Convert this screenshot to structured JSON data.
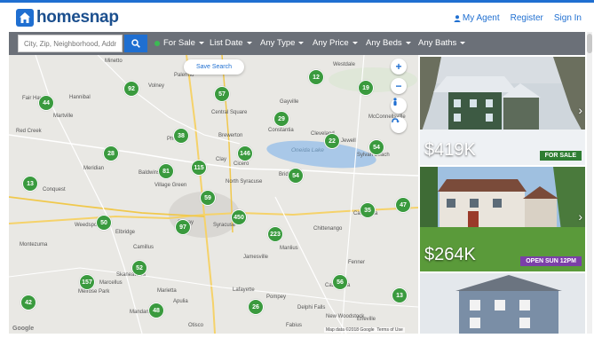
{
  "brand": {
    "name": "homesnap",
    "color": "#1f6fd1"
  },
  "nav": {
    "my_agent": "My Agent",
    "register": "Register",
    "sign_in": "Sign In"
  },
  "search": {
    "placeholder": "City, Zip, Neighborhood, Address"
  },
  "filters": {
    "status": "For Sale",
    "list_date": "List Date",
    "type": "Any Type",
    "price": "Any Price",
    "beds": "Any Beds",
    "baths": "Any Baths"
  },
  "map": {
    "save_search": "Save Search",
    "lake": "Oneida Lake",
    "attribution": "Map data ©2018 Google",
    "terms": "Terms of Use",
    "google": "Google",
    "towns": [
      "Minetto",
      "Palermo",
      "Volney",
      "Westdale",
      "Fair Haven",
      "Hannibal",
      "Martville",
      "Red Creek",
      "Central Square",
      "Gayville",
      "Constantia",
      "Cleveland",
      "McConnellsville",
      "Brewerton",
      "Sylvan Beach",
      "Jewell",
      "Phoenix",
      "Clay",
      "Cicero",
      "Meridian",
      "Baldwinsville",
      "Bridgeport",
      "Village Green",
      "North Syracuse",
      "Conquest",
      "Weedsport",
      "Elbridge",
      "Solvay",
      "Syracuse",
      "Chittenango",
      "Canastota",
      "Montezuma",
      "Camillus",
      "Manlius",
      "Jamesville",
      "Fenner",
      "Skaneateles",
      "Marcellus",
      "Lafayette",
      "Pompey",
      "Cazenovia",
      "Melrose Park",
      "Marietta",
      "Apulia",
      "Delphi Falls",
      "Mandana",
      "New Woodstock",
      "Otisco",
      "Fabius",
      "Erieville"
    ],
    "markers": [
      "44",
      "92",
      "57",
      "12",
      "19",
      "28",
      "38",
      "29",
      "22",
      "54",
      "146",
      "81",
      "115",
      "54",
      "13",
      "59",
      "450",
      "35",
      "47",
      "50",
      "97",
      "223",
      "52",
      "157",
      "56",
      "13",
      "42",
      "48",
      "26"
    ]
  },
  "listings": [
    {
      "price": "$419K",
      "badge": "FOR SALE",
      "badge_color": "#2e7d32"
    },
    {
      "price": "$264K",
      "badge": "OPEN SUN 12PM",
      "badge_color": "#7b3fa8"
    },
    {
      "price": "",
      "badge": "",
      "badge_color": ""
    }
  ]
}
